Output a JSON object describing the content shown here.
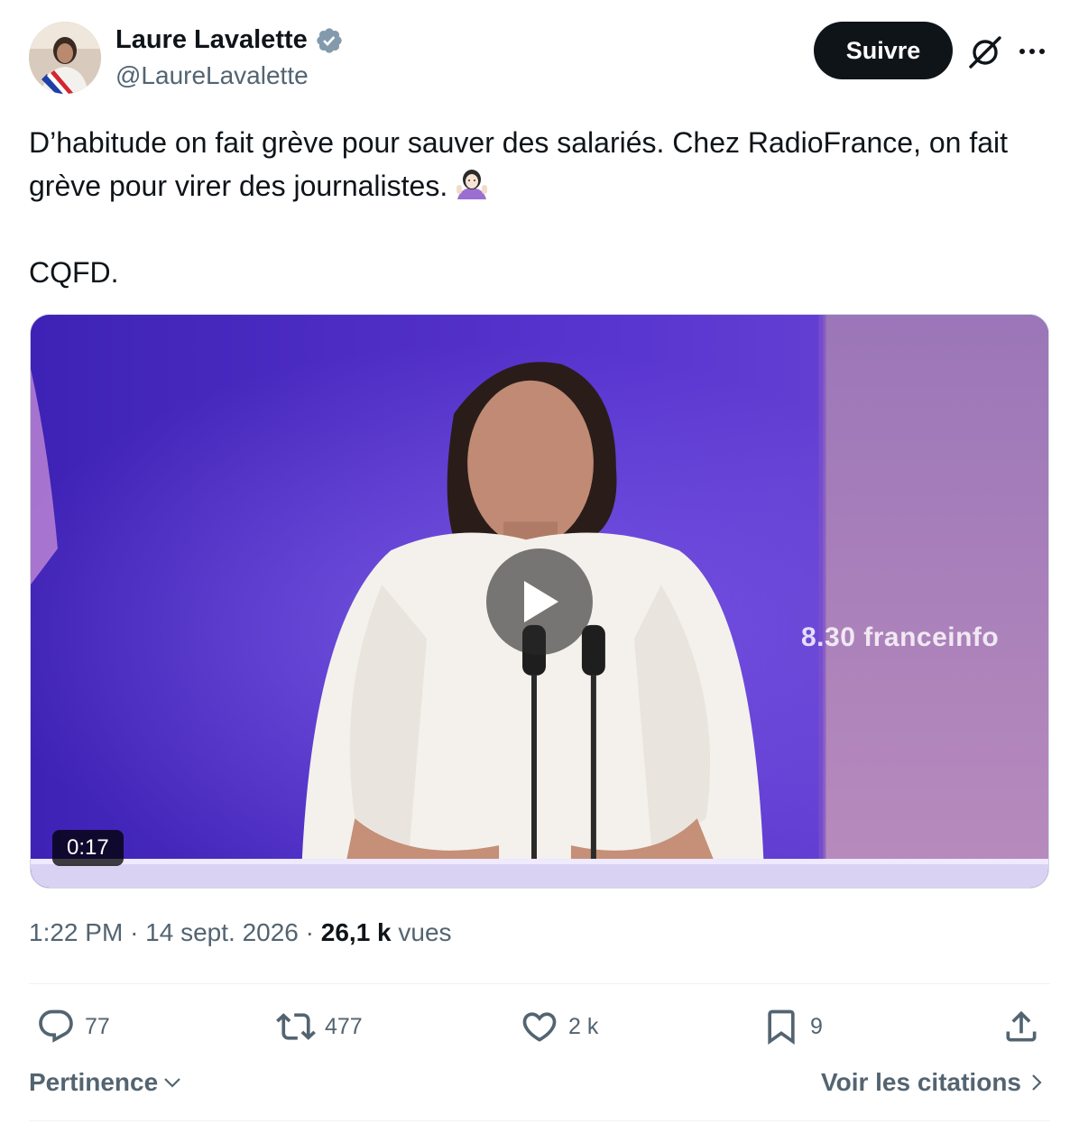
{
  "author": {
    "display_name": "Laure Lavalette",
    "handle": "@LaureLavalette"
  },
  "header": {
    "follow_label": "Suivre"
  },
  "tweet": {
    "text": "D’habitude on fait grève pour sauver des salariés. Chez RadioFrance, on fait grève pour virer des journalistes.",
    "text_line2": "CQFD."
  },
  "media": {
    "overlay_text": "8.30 franceinfo",
    "duration": "0:17"
  },
  "meta": {
    "time": "1:22 PM",
    "date": "14 sept. 2026",
    "views_count": "26,1 k",
    "views_label": "vues"
  },
  "actions": {
    "replies": "77",
    "reposts": "477",
    "likes": "2 k",
    "bookmarks": "9"
  },
  "footer": {
    "sort_label": "Pertinence",
    "quotes_label": "Voir les citations"
  },
  "colors": {
    "text_primary": "#0f1419",
    "text_secondary": "#536471",
    "verified": "#829aab",
    "follow_bg": "#0f1419"
  },
  "icons": [
    "verified-badge-icon",
    "grok-icon",
    "more-icon",
    "play-icon",
    "reply-icon",
    "repost-icon",
    "like-icon",
    "bookmark-icon",
    "share-icon",
    "chevron-down-icon",
    "chevron-right-icon",
    "shrug-emoji-icon"
  ]
}
